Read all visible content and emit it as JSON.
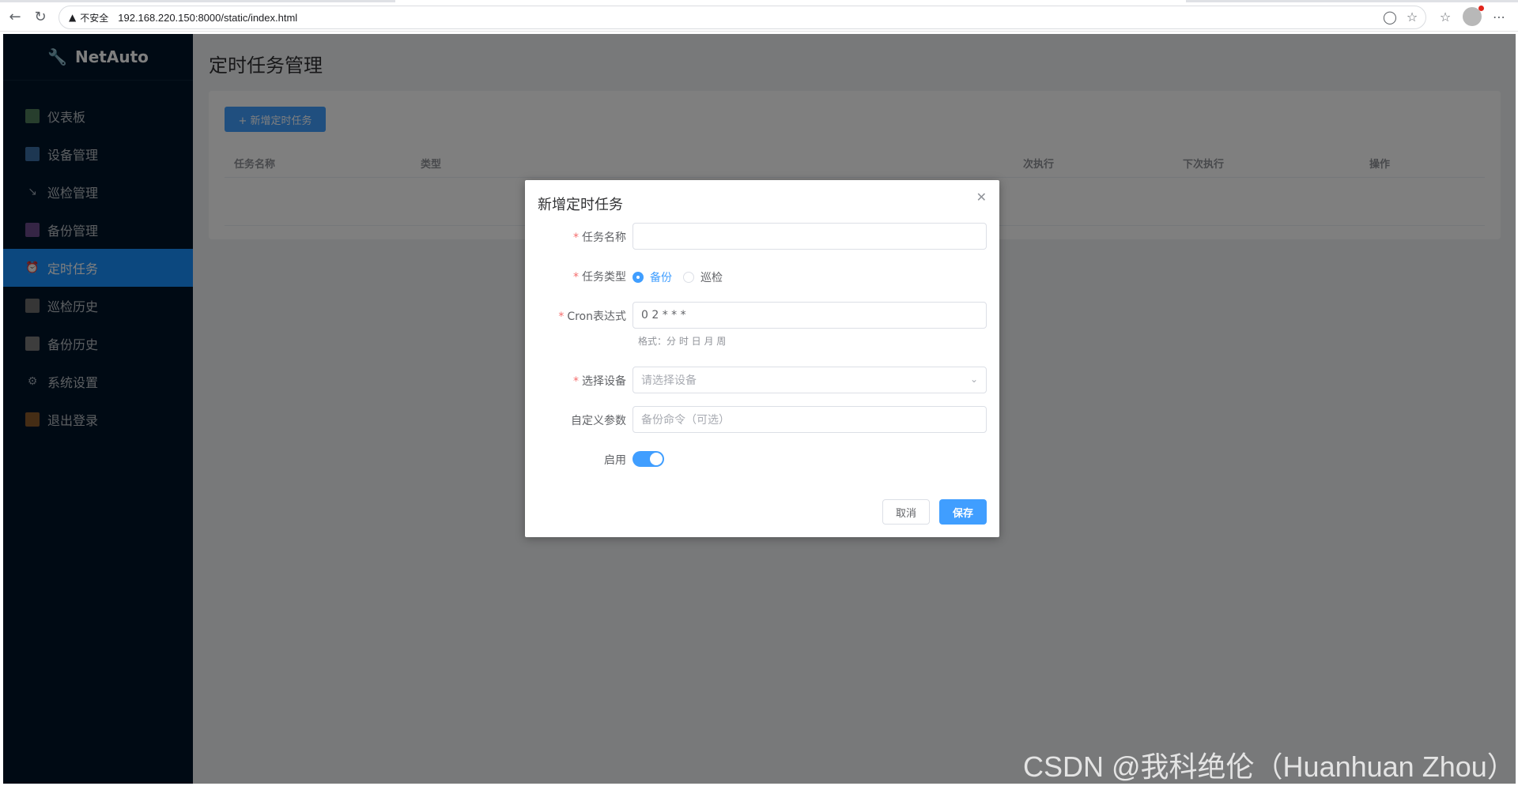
{
  "browser": {
    "security_label": "不安全",
    "url": "192.168.220.150:8000/static/index.html"
  },
  "sidebar": {
    "brand": "NetAuto",
    "items": [
      {
        "label": "仪表板",
        "icon": "bar-chart-icon",
        "active": false
      },
      {
        "label": "设备管理",
        "icon": "monitor-icon",
        "active": false
      },
      {
        "label": "巡检管理",
        "icon": "wrench-icon",
        "active": false
      },
      {
        "label": "备份管理",
        "icon": "floppy-disk-icon",
        "active": false
      },
      {
        "label": "定时任务",
        "icon": "alarm-clock-icon",
        "active": true
      },
      {
        "label": "巡检历史",
        "icon": "notebook-icon",
        "active": false
      },
      {
        "label": "备份历史",
        "icon": "notebook-icon",
        "active": false
      },
      {
        "label": "系统设置",
        "icon": "gear-icon",
        "active": false
      },
      {
        "label": "退出登录",
        "icon": "door-icon",
        "active": false
      }
    ]
  },
  "main": {
    "title": "定时任务管理",
    "add_button": "+ 新增定时任务",
    "table_headers": [
      "任务名称",
      "类型",
      "次执行",
      "下次执行",
      "操作"
    ]
  },
  "dialog": {
    "title": "新增定时任务",
    "fields": {
      "task_name": {
        "label": "任务名称",
        "value": ""
      },
      "task_type": {
        "label": "任务类型",
        "options": [
          "备份",
          "巡检"
        ],
        "selected": "备份"
      },
      "cron": {
        "label": "Cron表达式",
        "value": "0 2 * * *",
        "hint": "格式：分 时 日 月 周"
      },
      "devices": {
        "label": "选择设备",
        "placeholder": "请选择设备"
      },
      "custom_params": {
        "label": "自定义参数",
        "placeholder": "备份命令（可选）"
      },
      "enabled": {
        "label": "启用",
        "value": true
      }
    },
    "cancel": "取消",
    "save": "保存"
  },
  "watermark": "CSDN @我科绝伦（Huanhuan Zhou）"
}
